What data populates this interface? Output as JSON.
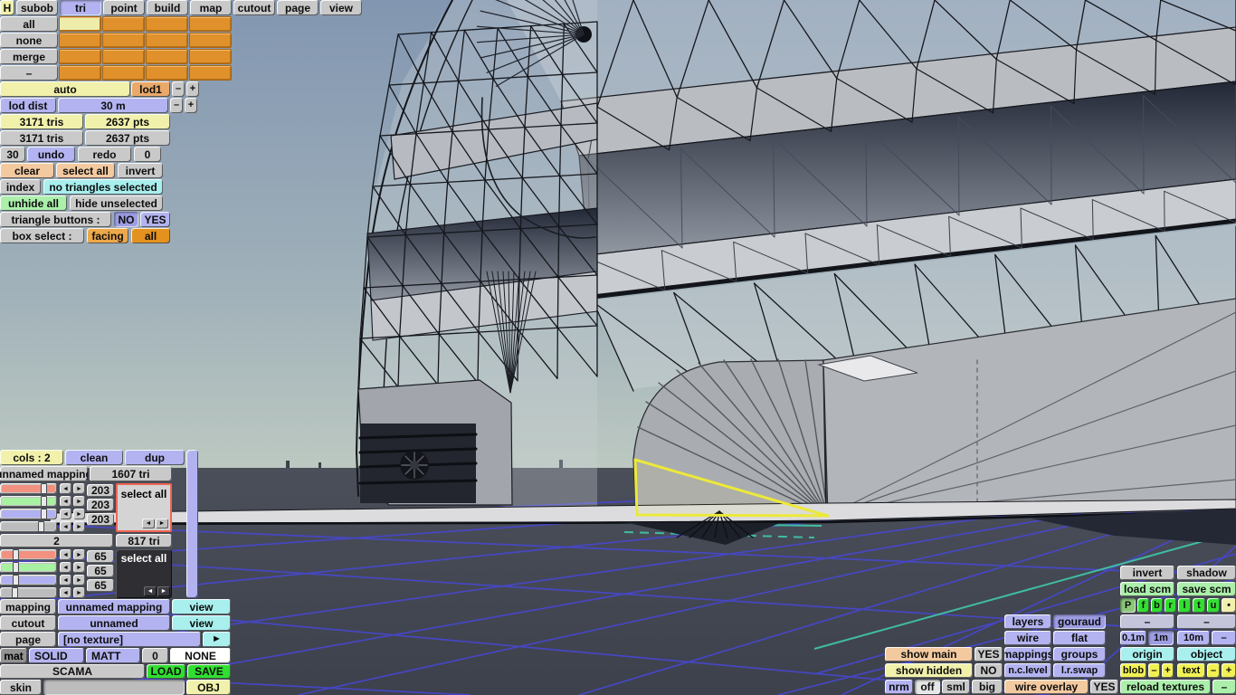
{
  "colors": {
    "selection_yellow": "#ece93a",
    "grid_blue": "#4747d0",
    "grid_teal": "#3fc9ac",
    "accent_orange": "#e3921f",
    "select_box_border": "#f16455"
  },
  "menu": {
    "items": [
      "H",
      "subob",
      "tri",
      "point",
      "build",
      "map",
      "cutout",
      "page",
      "view"
    ],
    "active": "tri"
  },
  "tri_panel": {
    "grid_rows": [
      "all",
      "none",
      "merge",
      "–"
    ],
    "auto": "auto",
    "lod": "lod1",
    "minus": "–",
    "plus": "+",
    "lod_dist_label": "lod dist",
    "lod_dist_value": "30 m",
    "selected_tris": "3171 tris",
    "selected_pts": "2637 pts",
    "total_tris": "3171 tris",
    "total_pts": "2637 pts",
    "undo_steps": "30",
    "undo": "undo",
    "redo": "redo",
    "redo_steps": "0",
    "clear": "clear",
    "select_all": "select all",
    "invert": "invert",
    "index": "index",
    "selection_status": "no triangles selected",
    "unhide_all": "unhide all",
    "hide_unselected": "hide unselected",
    "triangle_buttons_label": "triangle buttons :",
    "no": "NO",
    "yes": "YES",
    "box_select_label": "box select :",
    "facing": "facing",
    "all": "all"
  },
  "mappings_panel": {
    "cols": "cols : 2",
    "clean": "clean",
    "dup": "dup",
    "arrow_left": "◄",
    "arrow_right": "►",
    "groups": [
      {
        "name": "unnamed mapping",
        "tri_count": "1607 tri",
        "r": "203",
        "g": "203",
        "b": "203",
        "select_all": "select all"
      },
      {
        "name": "2",
        "tri_count": "817 tri",
        "r": "65",
        "g": "65",
        "b": "65",
        "select_all": "select all"
      }
    ],
    "mapping_label": "mapping",
    "mapping_value": "unnamed mapping",
    "view": "view",
    "cutout_label": "cutout",
    "cutout_value": "unnamed",
    "cutout_view": "view",
    "page_label": "page",
    "page_value": "[no texture]",
    "page_next": "►",
    "mat_label": "mat",
    "mat_type": "SOLID",
    "mat_shading": "MATT",
    "mat_num": "0",
    "mat_tex": "NONE",
    "scama": "SCAMA",
    "load": "LOAD",
    "save": "SAVE",
    "skin_label": "skin",
    "skin_value": "",
    "obj": "OBJ"
  },
  "right_panel": {
    "invert": "invert",
    "shadow": "shadow",
    "load_scm": "load scm",
    "save_scm": "save scm",
    "proj": [
      "P",
      "f",
      "b",
      "r",
      "l",
      "t",
      "u"
    ],
    "proj_dot": "•",
    "layers": "layers",
    "gouraud": "gouraud",
    "dash": "–",
    "plus": "+",
    "wire": "wire",
    "flat": "flat",
    "snap_01": "0.1m",
    "snap_1": "1m",
    "snap_10": "10m",
    "show_main": "show main",
    "show_main_value": "YES",
    "mappings": "mappings",
    "groups": "groups",
    "origin": "origin",
    "object": "object",
    "show_hidden": "show hidden",
    "show_hidden_value": "NO",
    "nc_level": "n.c.level",
    "lr_swap": "l.r.swap",
    "blob": "blob",
    "text": "text",
    "nrm": "nrm",
    "off": "off",
    "sml": "sml",
    "big": "big",
    "wire_overlay": "wire overlay",
    "wire_overlay_value": "YES",
    "reload_textures": "reload textures"
  }
}
